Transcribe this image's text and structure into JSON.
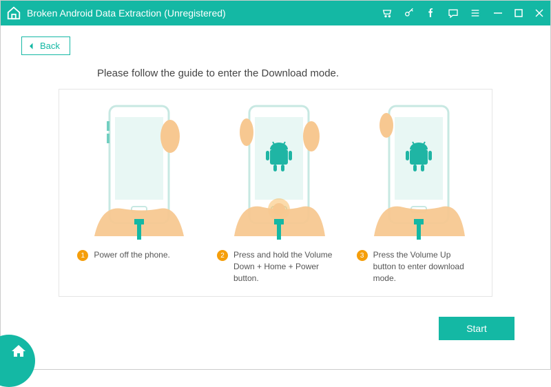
{
  "header": {
    "title": "Broken Android Data Extraction (Unregistered)"
  },
  "toolbar": {
    "back_label": "Back"
  },
  "main": {
    "instruction": "Please follow the guide to enter the Download mode.",
    "steps": [
      {
        "num": "1",
        "text": "Power off the phone."
      },
      {
        "num": "2",
        "text": "Press and hold the Volume Down + Home + Power button."
      },
      {
        "num": "3",
        "text": "Press the Volume Up button to enter download mode."
      }
    ],
    "start_label": "Start"
  },
  "colors": {
    "accent": "#14b8a4",
    "step_badge": "#f59e0b"
  }
}
